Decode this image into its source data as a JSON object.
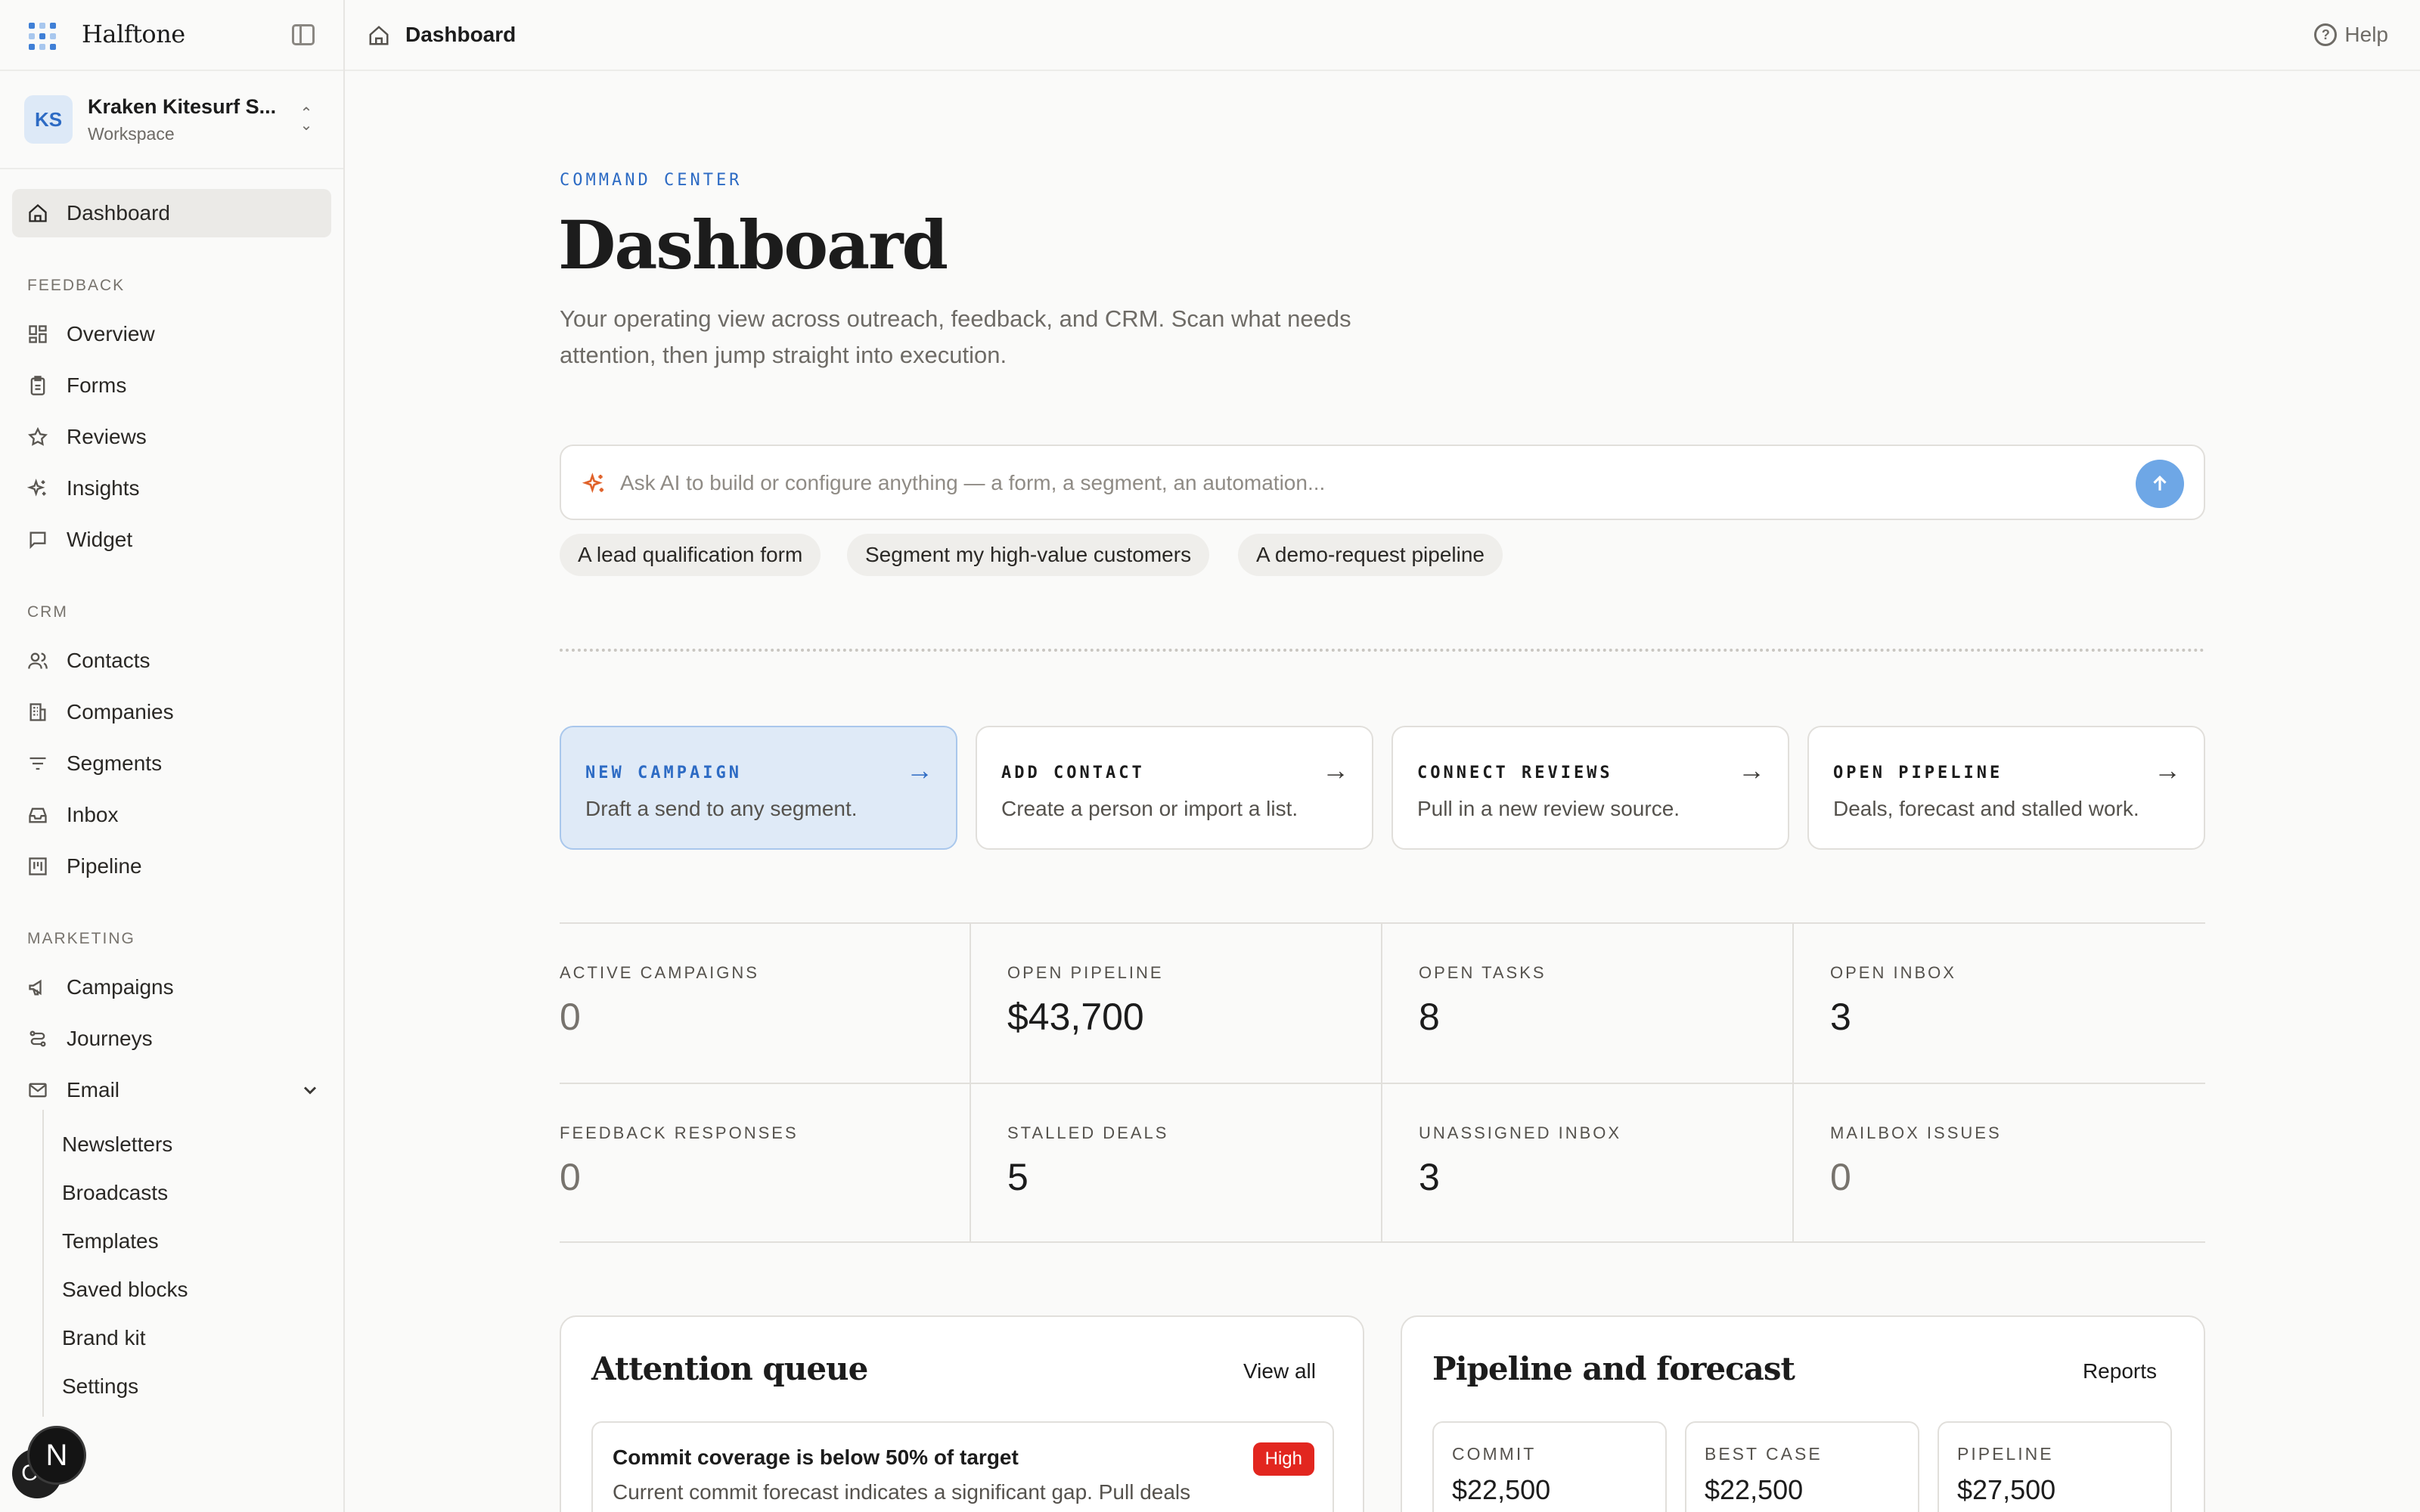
{
  "app": {
    "brand": "Halftone"
  },
  "workspace": {
    "initials": "KS",
    "name": "Kraken Kitesurf S...",
    "sub": "Workspace"
  },
  "nav": {
    "dashboard": "Dashboard",
    "sections": {
      "feedback": "FEEDBACK",
      "crm": "CRM",
      "marketing": "MARKETING"
    },
    "feedback": [
      "Overview",
      "Forms",
      "Reviews",
      "Insights",
      "Widget"
    ],
    "crm": [
      "Contacts",
      "Companies",
      "Segments",
      "Inbox",
      "Pipeline"
    ],
    "marketing": [
      "Campaigns",
      "Journeys",
      "Email"
    ],
    "email_sub": [
      "Newsletters",
      "Broadcasts",
      "Templates",
      "Saved blocks",
      "Brand kit",
      "Settings"
    ]
  },
  "topbar": {
    "title": "Dashboard",
    "help": "Help"
  },
  "hero": {
    "kicker": "COMMAND CENTER",
    "title": "Dashboard",
    "lead": "Your operating view across outreach, feedback, and CRM. Scan what needs attention, then jump straight into execution."
  },
  "ai": {
    "placeholder": "Ask AI to build or configure anything — a form, a segment, an automation...",
    "chips": [
      "A lead qualification form",
      "Segment my high-value customers",
      "A demo-request pipeline"
    ]
  },
  "actions": [
    {
      "title": "NEW CAMPAIGN",
      "desc": "Draft a send to any segment."
    },
    {
      "title": "ADD CONTACT",
      "desc": "Create a person or import a list."
    },
    {
      "title": "CONNECT REVIEWS",
      "desc": "Pull in a new review source."
    },
    {
      "title": "OPEN PIPELINE",
      "desc": "Deals, forecast and stalled work."
    }
  ],
  "stats": [
    {
      "label": "ACTIVE CAMPAIGNS",
      "value": "0"
    },
    {
      "label": "OPEN PIPELINE",
      "value": "$43,700"
    },
    {
      "label": "OPEN TASKS",
      "value": "8"
    },
    {
      "label": "OPEN INBOX",
      "value": "3"
    },
    {
      "label": "FEEDBACK RESPONSES",
      "value": "0"
    },
    {
      "label": "STALLED DEALS",
      "value": "5"
    },
    {
      "label": "UNASSIGNED INBOX",
      "value": "3"
    },
    {
      "label": "MAILBOX ISSUES",
      "value": "0"
    }
  ],
  "attention": {
    "title": "Attention queue",
    "link": "View all",
    "item": {
      "title": "Commit coverage is below 50% of target",
      "badge": "High",
      "desc": "Current commit forecast indicates a significant gap. Pull deals"
    }
  },
  "forecast": {
    "title": "Pipeline and forecast",
    "link": "Reports",
    "cards": [
      {
        "label": "COMMIT",
        "value": "$22,500"
      },
      {
        "label": "BEST CASE",
        "value": "$22,500"
      },
      {
        "label": "PIPELINE",
        "value": "$27,500"
      }
    ]
  },
  "floating": {
    "primary": "N",
    "secondary": "CS"
  },
  "colors": {
    "accent": "#2d6bc4",
    "accent_bg": "#dfeaf7",
    "danger": "#e2261f",
    "send": "#6ea7e6"
  }
}
